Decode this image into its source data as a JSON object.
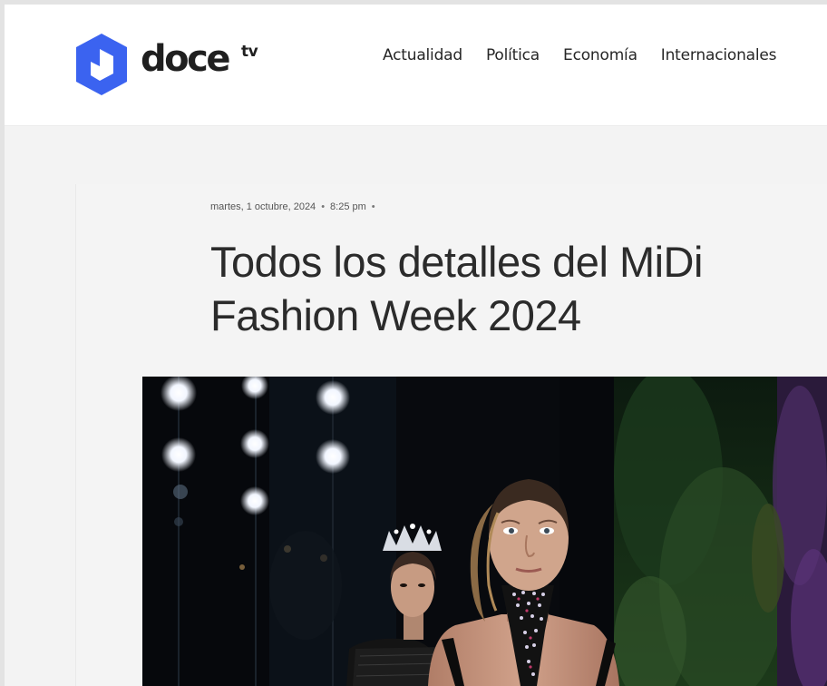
{
  "brand": {
    "name": "doce",
    "superscript": "tv",
    "color": "#3b63f0"
  },
  "nav": {
    "items": [
      "Actualidad",
      "Política",
      "Economía",
      "Internacionales"
    ]
  },
  "article": {
    "date": "martes, 1 octubre, 2024",
    "time": "8:25 pm",
    "title": "Todos los detalles del MiDi Fashion Week 2024"
  },
  "hero_image": {
    "subject": "runway-models"
  }
}
